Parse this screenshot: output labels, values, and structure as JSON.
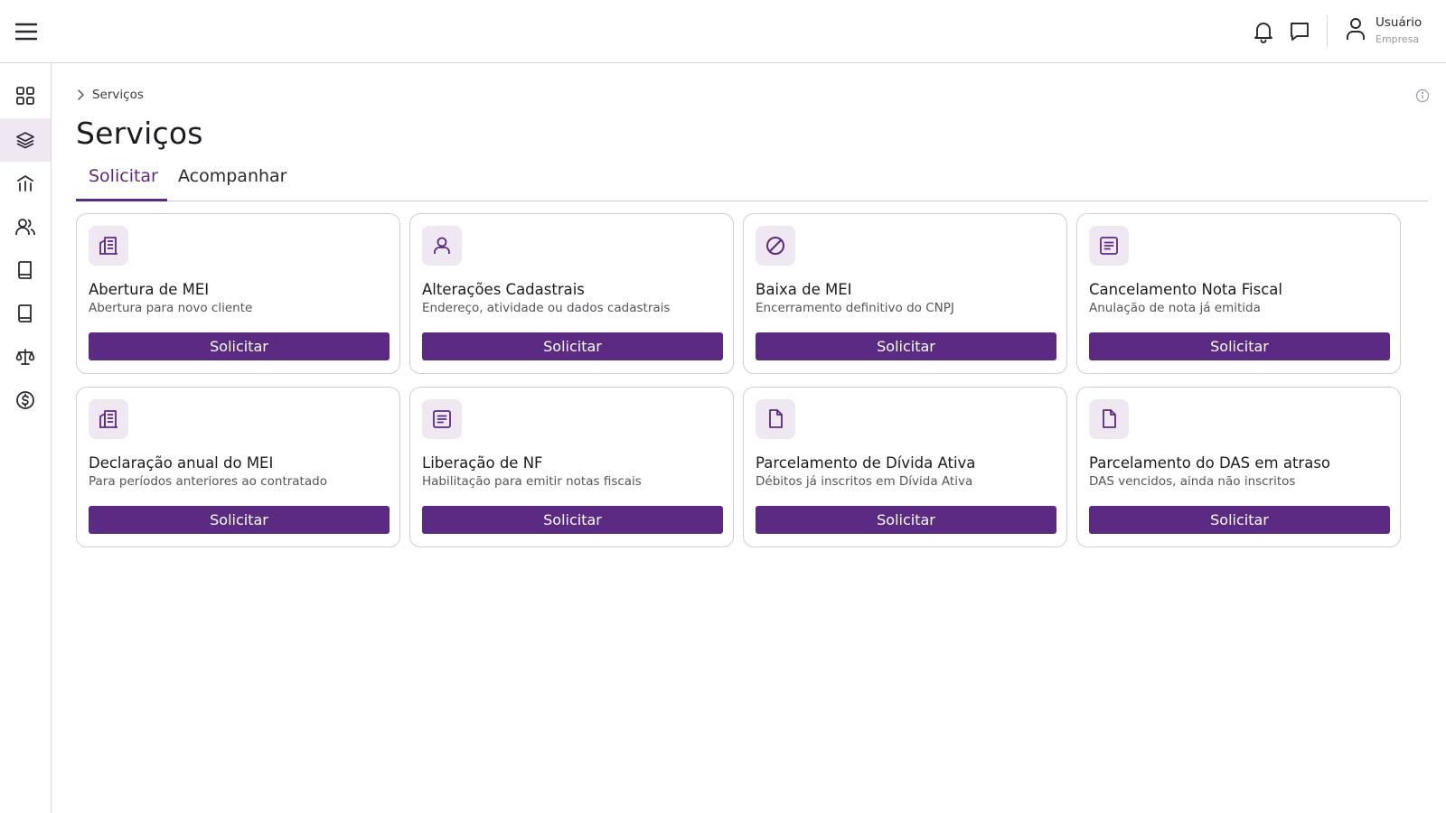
{
  "header": {
    "user": {
      "name": "Usuário",
      "subtitle": "Empresa"
    },
    "icons": [
      "menu-icon",
      "bell-icon",
      "chat-icon",
      "user-icon"
    ]
  },
  "sidebar": {
    "items": [
      {
        "icon": "grid-icon",
        "active": false
      },
      {
        "icon": "layers-icon",
        "active": true
      },
      {
        "icon": "building-chart-icon",
        "active": false
      },
      {
        "icon": "users-icon",
        "active": false
      },
      {
        "icon": "book-icon",
        "active": false
      },
      {
        "icon": "book-icon",
        "active": false
      },
      {
        "icon": "scale-icon",
        "active": false
      },
      {
        "icon": "dollar-circle-icon",
        "active": false
      }
    ]
  },
  "breadcrumb": {
    "current": "Serviços"
  },
  "page": {
    "title": "Serviços"
  },
  "tabs": [
    {
      "label": "Solicitar",
      "active": true
    },
    {
      "label": "Acompanhar",
      "active": false
    }
  ],
  "services": [
    {
      "icon": "building-icon",
      "title": "Abertura de MEI",
      "subtitle": "Abertura para novo cliente",
      "button": "Solicitar"
    },
    {
      "icon": "user-icon",
      "title": "Alterações Cadastrais",
      "subtitle": "Endereço, atividade ou dados cadastrais",
      "button": "Solicitar"
    },
    {
      "icon": "block-icon",
      "title": "Baixa de MEI",
      "subtitle": "Encerramento definitivo do CNPJ",
      "button": "Solicitar"
    },
    {
      "icon": "receipt-icon",
      "title": "Cancelamento Nota Fiscal",
      "subtitle": "Anulação de nota já emitida",
      "button": "Solicitar"
    },
    {
      "icon": "building-icon",
      "title": "Declaração anual do MEI",
      "subtitle": "Para períodos anteriores ao contratado",
      "button": "Solicitar"
    },
    {
      "icon": "receipt-icon",
      "title": "Liberação de NF",
      "subtitle": "Habilitação para emitir notas fiscais",
      "button": "Solicitar"
    },
    {
      "icon": "document-icon",
      "title": "Parcelamento de Dívida Ativa",
      "subtitle": "Débitos já inscritos em Dívida Ativa",
      "button": "Solicitar"
    },
    {
      "icon": "document-icon",
      "title": "Parcelamento do DAS em atraso",
      "subtitle": "DAS vencidos, ainda não inscritos",
      "button": "Solicitar"
    }
  ],
  "colors": {
    "accent": "#5b2a82",
    "icon_bg": "#efe8f3",
    "border": "#cfcfd4"
  }
}
